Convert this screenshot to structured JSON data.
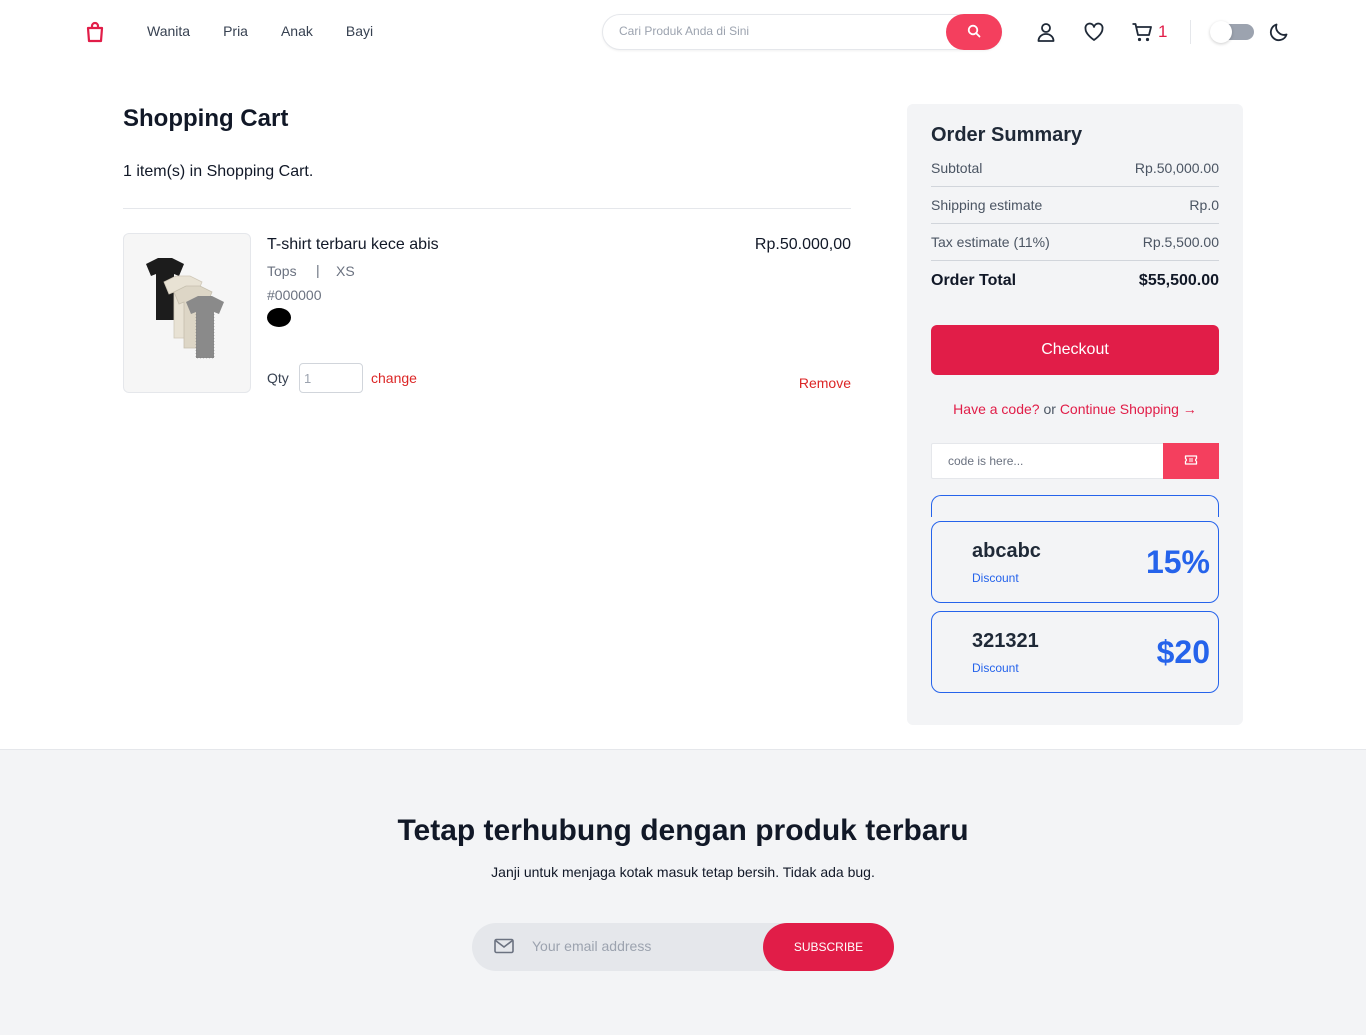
{
  "header": {
    "nav": [
      "Wanita",
      "Pria",
      "Anak",
      "Bayi"
    ],
    "search_placeholder": "Cari Produk Anda di Sini",
    "cart_count": "1",
    "brand_color": "#e11d48"
  },
  "cart": {
    "title": "Shopping Cart",
    "count_text": "1 item(s) in Shopping Cart.",
    "item": {
      "name": "T-shirt terbaru kece abis",
      "category": "Tops",
      "separator": "|",
      "size": "XS",
      "color_code": "#000000",
      "price": "Rp.50.000,00",
      "qty_label": "Qty",
      "qty_value": "1",
      "change_label": "change",
      "remove_label": "Remove"
    }
  },
  "summary": {
    "title": "Order Summary",
    "rows": [
      {
        "label": "Subtotal",
        "value": "Rp.50,000.00"
      },
      {
        "label": "Shipping estimate",
        "value": "Rp.0"
      },
      {
        "label": "Tax estimate (11%)",
        "value": "Rp.5,500.00"
      }
    ],
    "total_label": "Order Total",
    "total_value": "$55,500.00",
    "checkout_label": "Checkout",
    "code_question": "Have a code?",
    "code_or": "or",
    "continue_label": "Continue Shopping →",
    "code_placeholder": "code is here...",
    "coupons": [
      {
        "code": "abcabc",
        "label": "Discount",
        "value": "15%"
      },
      {
        "code": "321321",
        "label": "Discount",
        "value": "$20"
      }
    ]
  },
  "footer": {
    "title": "Tetap terhubung dengan produk terbaru",
    "subtitle": "Janji untuk menjaga kotak masuk tetap bersih. Tidak ada bug.",
    "email_placeholder": "Your email address",
    "subscribe_label": "SUBSCRIBE"
  }
}
